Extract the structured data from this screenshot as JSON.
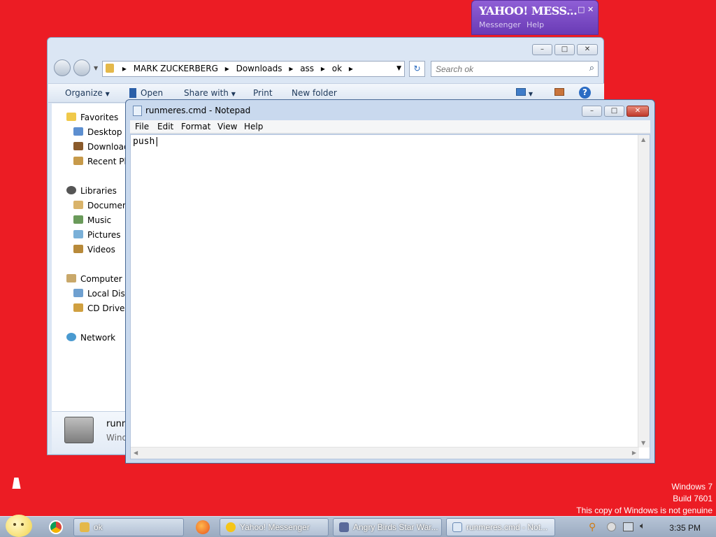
{
  "yahoo": {
    "logo": "YAHOO! MESS...",
    "menu": [
      "Messenger",
      "Help"
    ],
    "minimize": "–",
    "maximize": "□",
    "close": "✕"
  },
  "explorer": {
    "breadcrumbs": [
      "MARK ZUCKERBERG",
      "Downloads",
      "ass",
      "ok"
    ],
    "search_placeholder": "Search ok",
    "toolbar": {
      "organize": "Organize",
      "open": "Open",
      "share_with": "Share with",
      "print": "Print",
      "new_folder": "New folder"
    },
    "nav": {
      "favorites": "Favorites",
      "desktop": "Desktop",
      "downloads": "Download",
      "recent": "Recent Pla",
      "libraries": "Libraries",
      "documents": "Documen",
      "music": "Music",
      "pictures": "Pictures",
      "videos": "Videos",
      "computer": "Computer",
      "local_disk": "Local Disk",
      "cd_drive": "CD Drive (",
      "network": "Network"
    },
    "details": {
      "name": "runm",
      "type": "Wind"
    }
  },
  "notepad": {
    "title": "runmeres.cmd - Notepad",
    "menu": [
      "File",
      "Edit",
      "Format",
      "View",
      "Help"
    ],
    "content": "push"
  },
  "watermark": {
    "line1": "Windows 7",
    "line2": "Build 7601",
    "line3": "This copy of Windows is not genuine"
  },
  "taskbar": {
    "items": [
      {
        "label": "ok"
      },
      {
        "label": "Yahoo! Messenger"
      },
      {
        "label": "Angry Birds Star War..."
      },
      {
        "label": "runmeres.cmd - Not..."
      }
    ],
    "clock": "3:35 PM"
  }
}
